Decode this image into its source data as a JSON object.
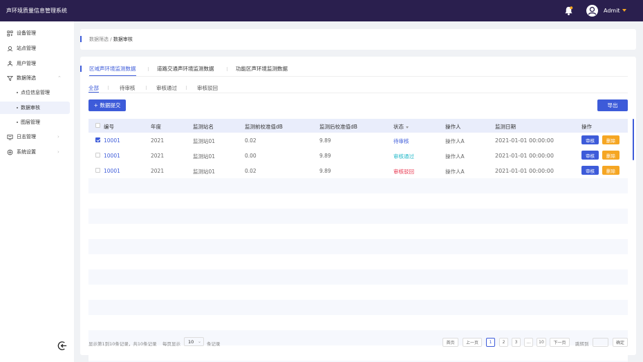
{
  "app": {
    "title": "声环境质量信息管理系统",
    "user": "Admit"
  },
  "sidebar": {
    "items": [
      {
        "label": "设备管理",
        "icon": "device-icon"
      },
      {
        "label": "站点管理",
        "icon": "location-icon"
      },
      {
        "label": "用户管理",
        "icon": "users-icon"
      },
      {
        "label": "数据筛选",
        "icon": "filter-icon"
      },
      {
        "label": "日志管理",
        "icon": "log-icon"
      },
      {
        "label": "系统设置",
        "icon": "settings-icon"
      }
    ],
    "sub_items": [
      {
        "label": "点位信息管理"
      },
      {
        "label": "数据审核"
      },
      {
        "label": "图层管理"
      }
    ]
  },
  "breadcrumb": {
    "parent": "数据筛选",
    "sep": "/",
    "current": "数据审核"
  },
  "tabs": [
    {
      "label": "区域声环境监测数据"
    },
    {
      "label": "道路交通声环境监测数据"
    },
    {
      "label": "功能区声环境监测数据"
    }
  ],
  "filters": [
    {
      "label": "全部"
    },
    {
      "label": "待审核"
    },
    {
      "label": "审核通过"
    },
    {
      "label": "审核驳回"
    }
  ],
  "toolbar": {
    "submit_label": "+ 数据提交",
    "export_label": "导出"
  },
  "table": {
    "headers": [
      "编号",
      "年度",
      "监测站名",
      "监测前校准值dB",
      "监测后校准值dB",
      "状态",
      "操作人",
      "监测日期",
      "操作"
    ],
    "rows": [
      {
        "id": "10001",
        "year": "2021",
        "station": "监测站01",
        "before": "0.02",
        "after": "9.89",
        "status": "待审核",
        "operator": "操作人A",
        "date": "2021-01-01 00:00:00",
        "checked": true
      },
      {
        "id": "10001",
        "year": "2021",
        "station": "监测站01",
        "before": "0.00",
        "after": "9.89",
        "status": "审核通过",
        "operator": "操作人A",
        "date": "2021-01-01 00:00:00",
        "checked": false
      },
      {
        "id": "10001",
        "year": "2021",
        "station": "监测站01",
        "before": "0.02",
        "after": "9.89",
        "status": "审核驳回",
        "operator": "操作人A",
        "date": "2021-01-01 00:00:00",
        "checked": false
      }
    ],
    "audit_label": "审核",
    "delete_label": "删除"
  },
  "pagination": {
    "info": "显示第1到10条记录，共10条记录",
    "per_page_label": "每页显示",
    "per_page_value": "10",
    "unit_label": "条记录",
    "first": "首页",
    "prev": "上一页",
    "pages": [
      "1",
      "2",
      "3",
      "...",
      "10"
    ],
    "next": "下一页",
    "jump_label": "跳转到",
    "confirm": "确定"
  },
  "colors": {
    "primary": "#3d5bd9",
    "topbar": "#2a1f4e",
    "warning": "#f5a623",
    "success": "#20b8c8",
    "danger": "#e8364f"
  }
}
